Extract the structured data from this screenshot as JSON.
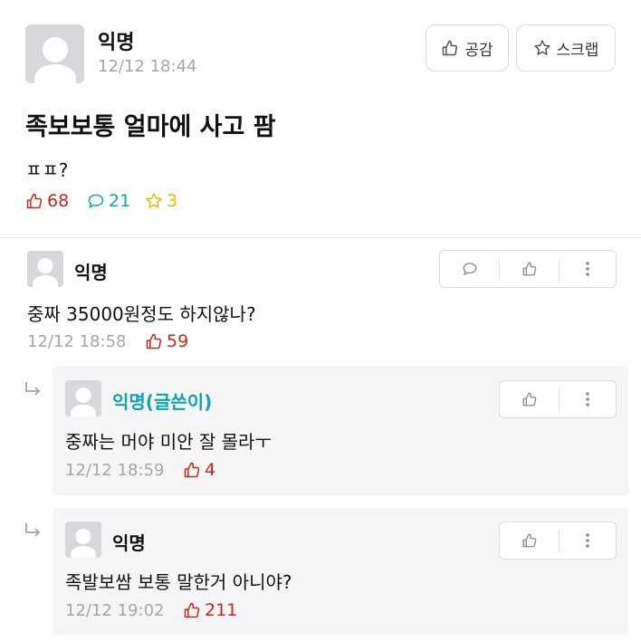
{
  "post": {
    "author": "익명",
    "time": "12/12 18:44",
    "like_label": "공감",
    "scrap_label": "스크랩",
    "title": "족보보통 얼마에 사고 팜",
    "body": "ㅍㅍ?",
    "likes": "68",
    "comments": "21",
    "scraps": "3"
  },
  "comment": {
    "author": "익명",
    "text": "중짜 35000원정도 하지않나?",
    "time": "12/12 18:58",
    "likes": "59"
  },
  "replies": [
    {
      "author": "익명(글쓴이)",
      "text": "중짜는 머야 미안 잘 몰라ㅜ",
      "time": "12/12 18:59",
      "likes": "4"
    },
    {
      "author": "익명",
      "text": "족발보쌈 보통 말한거 아니야?",
      "time": "12/12 19:02",
      "likes": "211"
    }
  ],
  "colors": {
    "like": "#c62917",
    "comment": "#0ca5b0",
    "scrap": "#f2b600",
    "op_name": "#0ca5b0",
    "meta": "#a6a6a6"
  }
}
